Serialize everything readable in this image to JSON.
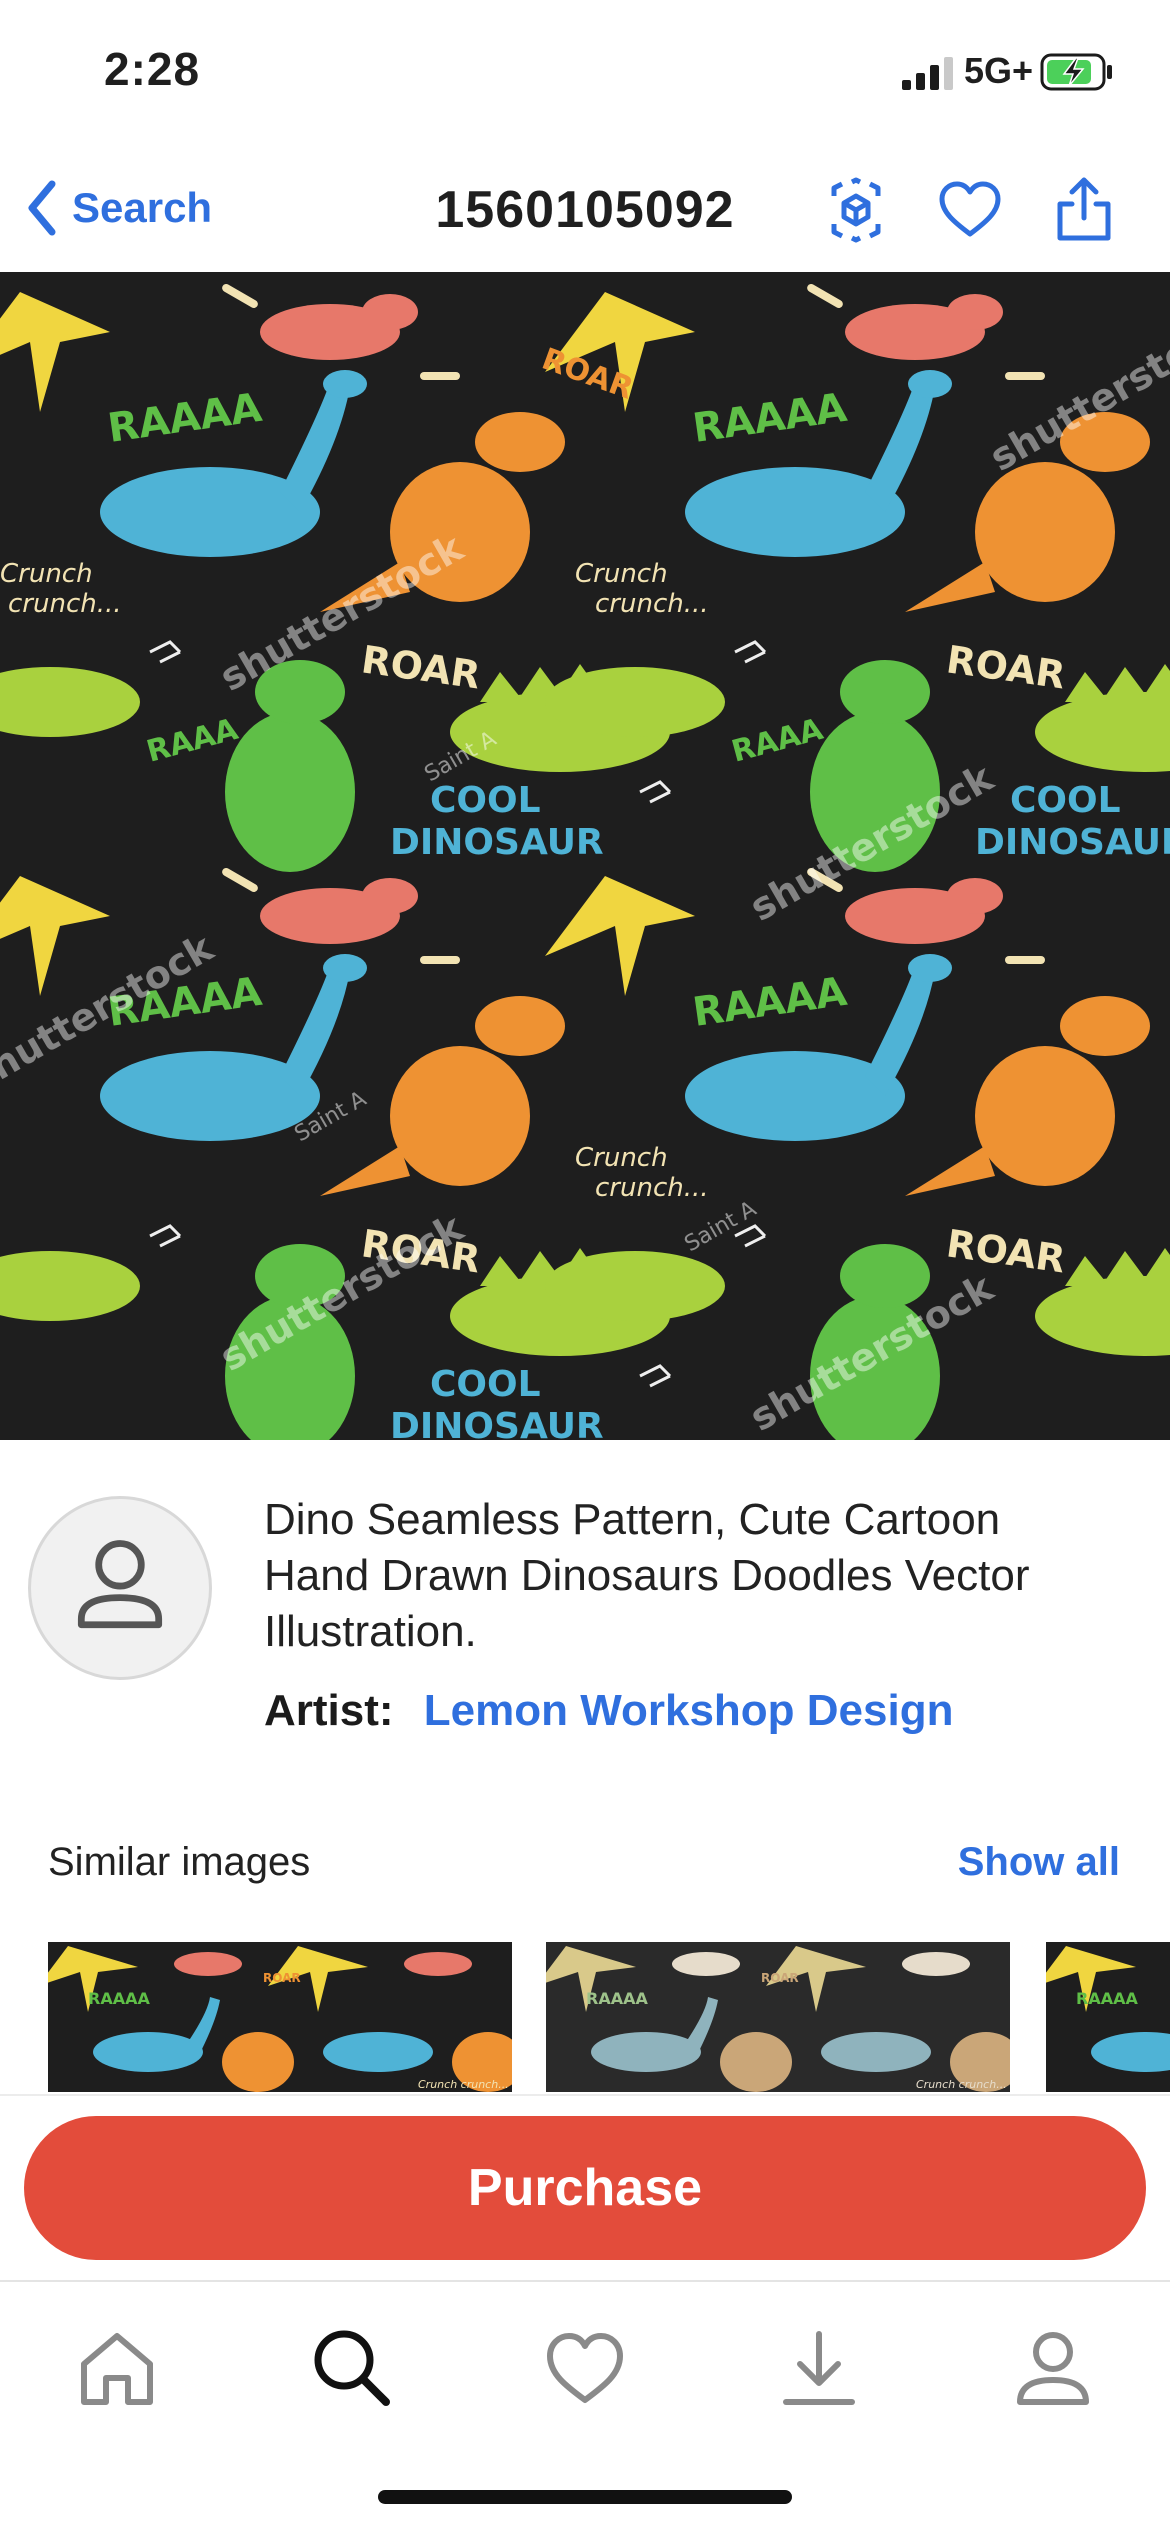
{
  "status_bar": {
    "time": "2:28",
    "network": "5G+",
    "icons": [
      "signal-icon",
      "battery-charging-icon"
    ]
  },
  "nav": {
    "back_label": "Search",
    "title": "1560105092",
    "icons": [
      "chevron-left-icon",
      "ar-view-icon",
      "heart-icon",
      "share-icon"
    ]
  },
  "hero": {
    "pattern_words": [
      "RAAAA",
      "ROAR",
      "COOL",
      "DINOSAUR",
      "RAAA",
      "Crunch",
      "crunch...",
      "shutterstock",
      "Saint A"
    ],
    "colors": {
      "background": "#1e1e1e",
      "yellow": "#f0d640",
      "blue": "#4fb3d6",
      "orange": "#ee9233",
      "green": "#5fbf47",
      "lime": "#a9d13e",
      "salmon": "#e7786a"
    }
  },
  "info": {
    "description": "Dino Seamless Pattern, Cute Cartoon Hand Drawn Dinosaurs Doodles Vector Illustration.",
    "artist_label": "Artist:",
    "artist_name": "Lemon Workshop Design",
    "avatar_icon": "user-icon"
  },
  "similar": {
    "title": "Similar images",
    "show_all": "Show all",
    "thumbnails": [
      {
        "theme": "dark-colorful",
        "words": [
          "RAAAA",
          "ROAR",
          "Crunch crunch..."
        ]
      },
      {
        "theme": "dark-muted",
        "words": [
          "RAAAA",
          "ROAR",
          "Crunch crunch..."
        ]
      },
      {
        "theme": "dark-colorful",
        "words": [
          "RAAAA"
        ]
      }
    ]
  },
  "purchase": {
    "label": "Purchase"
  },
  "tabbar": {
    "items": [
      "home-icon",
      "search-icon",
      "favorites-icon",
      "downloads-icon",
      "account-icon"
    ],
    "active": "search-icon"
  },
  "accent": "#2f6fde",
  "purchase_color": "#e34c3b"
}
